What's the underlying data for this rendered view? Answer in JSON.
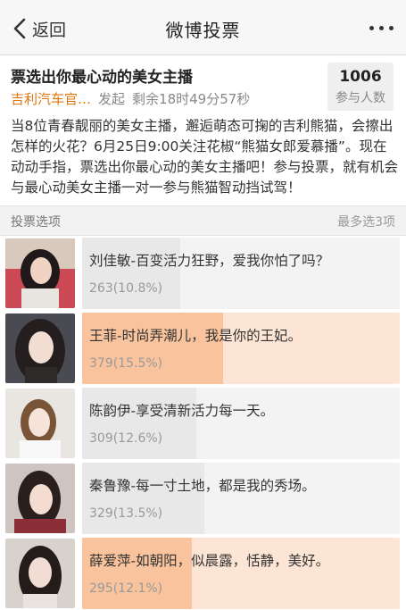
{
  "nav": {
    "back_label": "返回",
    "title": "微博投票"
  },
  "poll": {
    "title": "票选出你最心动的美女主播",
    "author": "吉利汽车官…",
    "launch": "发起",
    "remaining": "剩余18时49分57秒",
    "participants_count": "1006",
    "participants_label": "参与人数",
    "description": "当8位青春靓丽的美女主播，邂逅萌态可掬的吉利熊猫，会擦出怎样的火花？6月25日9:00关注花椒“熊猫女郎爱慕播”。现在动动手指，票选出你最心动的美女主播吧！参与投票，就有机会与最心动美女主播一对一参与熊猫智动挡试驾！"
  },
  "section": {
    "left": "投票选项",
    "right": "最多选3项"
  },
  "options": [
    {
      "text": "刘佳敏-百变活力狂野，爱我你怕了吗？",
      "votes": "263(10.8%)",
      "percent": 10.8,
      "selected": false,
      "photo": "photo-1"
    },
    {
      "text": "王菲-时尚弄潮儿，我是你的王妃。",
      "votes": "379(15.5%)",
      "percent": 15.5,
      "selected": true,
      "photo": "photo-2"
    },
    {
      "text": "陈韵伊-享受清新活力每一天。",
      "votes": "309(12.6%)",
      "percent": 12.6,
      "selected": false,
      "photo": "photo-3"
    },
    {
      "text": "秦鲁豫-每一寸土地，都是我的秀场。",
      "votes": "329(13.5%)",
      "percent": 13.5,
      "selected": false,
      "photo": "photo-4"
    },
    {
      "text": "薛爱萍-如朝阳，似晨露，恬静，美好。",
      "votes": "295(12.1%)",
      "percent": 12.1,
      "selected": true,
      "photo": "photo-5"
    }
  ]
}
